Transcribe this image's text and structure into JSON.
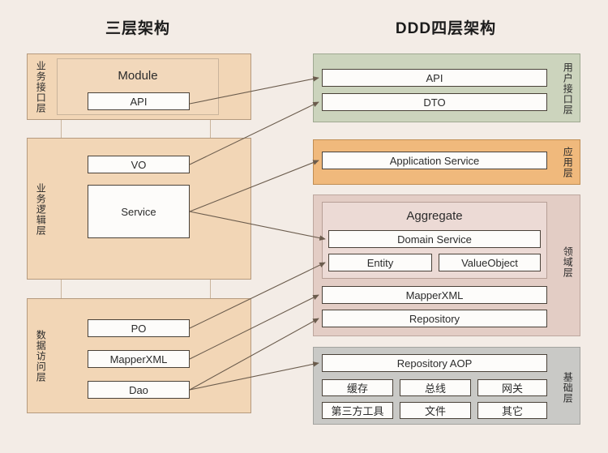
{
  "titles": {
    "left": "三层架构",
    "right": "DDD四层架构"
  },
  "left_architecture": {
    "module_group_label": "Module",
    "layers": [
      {
        "id": "business-interface",
        "label": "业务接口层",
        "items": [
          "API"
        ]
      },
      {
        "id": "business-logic",
        "label": "业务逻辑层",
        "items": [
          "VO",
          "Service"
        ]
      },
      {
        "id": "data-access",
        "label": "数据访问层",
        "items": [
          "PO",
          "MapperXML",
          "Dao"
        ]
      }
    ]
  },
  "right_architecture": {
    "aggregate_group_label": "Aggregate",
    "layers": [
      {
        "id": "user-interface",
        "label": "用户接口层",
        "color": "#ccd4bd",
        "items": [
          "API",
          "DTO"
        ]
      },
      {
        "id": "application",
        "label": "应用层",
        "color": "#f0b97c",
        "items": [
          "Application Service"
        ]
      },
      {
        "id": "domain",
        "label": "领域层",
        "color": "#e3cdc5",
        "items": [
          "Domain Service",
          "Entity",
          "ValueObject",
          "MapperXML",
          "Repository"
        ]
      },
      {
        "id": "infrastructure",
        "label": "基础层",
        "color": "#c9c9c6",
        "items": [
          "Repository AOP",
          "缓存",
          "总线",
          "网关",
          "第三方工具",
          "文件",
          "其它"
        ]
      }
    ]
  },
  "connections": [
    {
      "from": "API",
      "to": "API"
    },
    {
      "from": "VO",
      "to": "DTO"
    },
    {
      "from": "Service",
      "to": "Application Service"
    },
    {
      "from": "Service",
      "to": "Domain Service"
    },
    {
      "from": "PO",
      "to": "Entity"
    },
    {
      "from": "MapperXML",
      "to": "MapperXML"
    },
    {
      "from": "Dao",
      "to": "Repository"
    },
    {
      "from": "Dao",
      "to": "Repository AOP"
    }
  ],
  "colors": {
    "page_background": "#f3ece6",
    "left_layer": "#f2d6b6",
    "box_fill": "#fdfcfa",
    "arrow": "#6b5c4d"
  }
}
